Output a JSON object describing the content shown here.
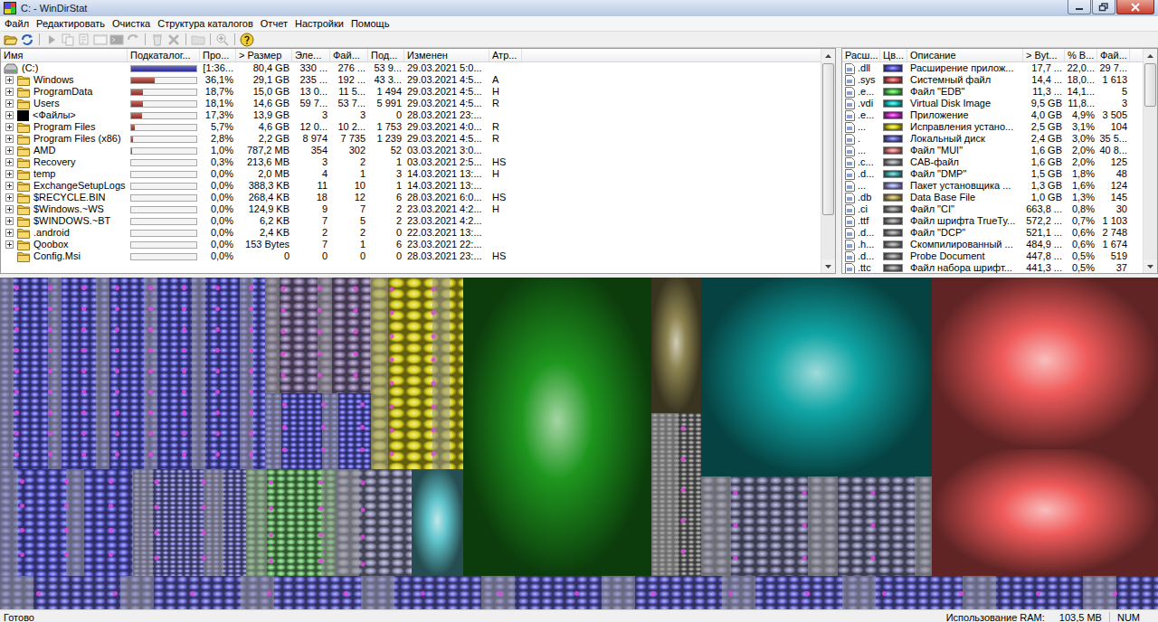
{
  "window": {
    "title": "C: - WinDirStat"
  },
  "menu": [
    "Файл",
    "Редактировать",
    "Очистка",
    "Структура каталогов",
    "Отчет",
    "Настройки",
    "Помощь"
  ],
  "toolbar": [
    {
      "disabled": false
    },
    {
      "disabled": false
    },
    {
      "disabled": true
    },
    {
      "disabled": true
    },
    {
      "disabled": true
    },
    {
      "disabled": true
    },
    {
      "disabled": true
    },
    {
      "disabled": true
    },
    {
      "disabled": true
    },
    {
      "disabled": true
    },
    {
      "disabled": true
    },
    {
      "disabled": true
    },
    {
      "disabled": false
    }
  ],
  "directory_list": {
    "columns": [
      "Имя",
      "Подкаталог...",
      "Про...",
      "> Размер",
      "Эле...",
      "Фай...",
      "Под...",
      "Изменен",
      "Атр..."
    ],
    "scrollbar": {
      "level": 0.78
    },
    "rows": [
      {
        "kind": "drive",
        "expandable": false,
        "name": "(C:)",
        "level": 1.0,
        "percent": "[1:36...",
        "size": "80,4 GB",
        "items": "330 ...",
        "files": "276 ...",
        "subdirs": "53 9...",
        "modified": "29.03.2021 5:0...",
        "attributes": ""
      },
      {
        "kind": "folder",
        "expandable": true,
        "name": "Windows",
        "level": 0.361,
        "percent": "36,1%",
        "size": "29,1 GB",
        "items": "235 ...",
        "files": "192 ...",
        "subdirs": "43 3...",
        "modified": "29.03.2021 4:5...",
        "attributes": "A"
      },
      {
        "kind": "folder",
        "expandable": true,
        "name": "ProgramData",
        "level": 0.187,
        "percent": "18,7%",
        "size": "15,0 GB",
        "items": "13 0...",
        "files": "11 5...",
        "subdirs": "1 494",
        "modified": "29.03.2021 4:5...",
        "attributes": "H"
      },
      {
        "kind": "folder",
        "expandable": true,
        "name": "Users",
        "level": 0.181,
        "percent": "18,1%",
        "size": "14,6 GB",
        "items": "59 7...",
        "files": "53 7...",
        "subdirs": "5 991",
        "modified": "29.03.2021 4:5...",
        "attributes": "R"
      },
      {
        "kind": "files",
        "expandable": true,
        "name": "<Файлы>",
        "level": 0.173,
        "percent": "17,3%",
        "size": "13,9 GB",
        "items": "3",
        "files": "3",
        "subdirs": "0",
        "modified": "28.03.2021 23:...",
        "attributes": ""
      },
      {
        "kind": "folder",
        "expandable": true,
        "name": "Program Files",
        "level": 0.057,
        "percent": "5,7%",
        "size": "4,6 GB",
        "items": "12 0...",
        "files": "10 2...",
        "subdirs": "1 753",
        "modified": "29.03.2021 4:0...",
        "attributes": "R"
      },
      {
        "kind": "folder",
        "expandable": true,
        "name": "Program Files (x86)",
        "level": 0.028,
        "percent": "2,8%",
        "size": "2,2 GB",
        "items": "8 974",
        "files": "7 735",
        "subdirs": "1 239",
        "modified": "29.03.2021 4:5...",
        "attributes": "R"
      },
      {
        "kind": "folder",
        "expandable": true,
        "name": "AMD",
        "level": 0.01,
        "percent": "1,0%",
        "size": "787,2 MB",
        "items": "354",
        "files": "302",
        "subdirs": "52",
        "modified": "03.03.2021 3:0...",
        "attributes": ""
      },
      {
        "kind": "folder",
        "expandable": true,
        "name": "Recovery",
        "level": 0.003,
        "percent": "0,3%",
        "size": "213,6 MB",
        "items": "3",
        "files": "2",
        "subdirs": "1",
        "modified": "03.03.2021 2:5...",
        "attributes": "HS"
      },
      {
        "kind": "folder",
        "expandable": true,
        "name": "temp",
        "level": 0.0,
        "percent": "0,0%",
        "size": "2,0 MB",
        "items": "4",
        "files": "1",
        "subdirs": "3",
        "modified": "14.03.2021 13:...",
        "attributes": "H"
      },
      {
        "kind": "folder",
        "expandable": true,
        "name": "ExchangeSetupLogs",
        "level": 0.0,
        "percent": "0,0%",
        "size": "388,3 KB",
        "items": "11",
        "files": "10",
        "subdirs": "1",
        "modified": "14.03.2021 13:...",
        "attributes": ""
      },
      {
        "kind": "folder",
        "expandable": true,
        "name": "$RECYCLE.BIN",
        "level": 0.0,
        "percent": "0,0%",
        "size": "268,4 KB",
        "items": "18",
        "files": "12",
        "subdirs": "6",
        "modified": "28.03.2021 6:0...",
        "attributes": "HS"
      },
      {
        "kind": "folder",
        "expandable": true,
        "name": "$Windows.~WS",
        "level": 0.0,
        "percent": "0,0%",
        "size": "124,9 KB",
        "items": "9",
        "files": "7",
        "subdirs": "2",
        "modified": "23.03.2021 4:2...",
        "attributes": "H"
      },
      {
        "kind": "folder",
        "expandable": true,
        "name": "$WINDOWS.~BT",
        "level": 0.0,
        "percent": "0,0%",
        "size": "6,2 KB",
        "items": "7",
        "files": "5",
        "subdirs": "2",
        "modified": "23.03.2021 4:2...",
        "attributes": ""
      },
      {
        "kind": "folder",
        "expandable": true,
        "name": ".android",
        "level": 0.0,
        "percent": "0,0%",
        "size": "2,4 KB",
        "items": "2",
        "files": "2",
        "subdirs": "0",
        "modified": "22.03.2021 13:...",
        "attributes": ""
      },
      {
        "kind": "folder",
        "expandable": true,
        "name": "Qoobox",
        "level": 0.0,
        "percent": "0,0%",
        "size": "153 Bytes",
        "items": "7",
        "files": "1",
        "subdirs": "6",
        "modified": "23.03.2021 22:...",
        "attributes": ""
      },
      {
        "kind": "folder",
        "expandable": false,
        "name": "Config.Msi",
        "level": 0.0,
        "percent": "0,0%",
        "size": "0",
        "items": "0",
        "files": "0",
        "subdirs": "0",
        "modified": "28.03.2021 23:...",
        "attributes": "HS"
      }
    ]
  },
  "extension_list": {
    "columns": [
      "Расш...",
      "Цв...",
      "Описание",
      "> Byt...",
      "% B...",
      "Фай..."
    ],
    "scrollbar": {
      "level": 0.22
    },
    "rows": [
      {
        "ext": ".dll",
        "color": "#6a6af0",
        "description": "Расширение прилож...",
        "bytes": "17,7 ...",
        "percent": "22,0...",
        "files": "29 7..."
      },
      {
        "ext": ".sys",
        "color": "#f06464",
        "description": "Системный файл",
        "bytes": "14,4 ...",
        "percent": "18,0...",
        "files": "1 613"
      },
      {
        "ext": ".e...",
        "color": "#64e064",
        "description": "Файл \"EDB\"",
        "bytes": "11,3 ...",
        "percent": "14,1...",
        "files": "5"
      },
      {
        "ext": ".vdi",
        "color": "#20dcdc",
        "description": "Virtual Disk Image",
        "bytes": "9,5 GB",
        "percent": "11,8...",
        "files": "3"
      },
      {
        "ext": ".e...",
        "color": "#e040e0",
        "description": "Приложение",
        "bytes": "4,0 GB",
        "percent": "4,9%",
        "files": "3 505"
      },
      {
        "ext": "...",
        "color": "#e0e020",
        "description": "Исправления устано...",
        "bytes": "2,5 GB",
        "percent": "3,1%",
        "files": "104"
      },
      {
        "ext": ".",
        "color": "#7676d8",
        "description": "Локальный диск",
        "bytes": "2,4 GB",
        "percent": "3,0%",
        "files": "35 5..."
      },
      {
        "ext": "...",
        "color": "#f08c8c",
        "description": "Файл \"MUI\"",
        "bytes": "1,6 GB",
        "percent": "2,0%",
        "files": "40 8..."
      },
      {
        "ext": ".c...",
        "color": "#a8a8a8",
        "description": "CAB-файл",
        "bytes": "1,6 GB",
        "percent": "2,0%",
        "files": "125"
      },
      {
        "ext": ".d...",
        "color": "#50bcbc",
        "description": "Файл \"DMP\"",
        "bytes": "1,5 GB",
        "percent": "1,8%",
        "files": "48"
      },
      {
        "ext": "...",
        "color": "#a8a8e8",
        "description": "Пакет установщика ...",
        "bytes": "1,3 GB",
        "percent": "1,6%",
        "files": "124"
      },
      {
        "ext": ".db",
        "color": "#c8b464",
        "description": "Data Base File",
        "bytes": "1,0 GB",
        "percent": "1,3%",
        "files": "145"
      },
      {
        "ext": ".ci",
        "color": "#a0a0a0",
        "description": "Файл \"CI\"",
        "bytes": "663,8 ...",
        "percent": "0,8%",
        "files": "30"
      },
      {
        "ext": ".ttf",
        "color": "#a0a0a0",
        "description": "Файл шрифта TrueTy...",
        "bytes": "572,2 ...",
        "percent": "0,7%",
        "files": "1 103"
      },
      {
        "ext": ".d...",
        "color": "#a0a0a0",
        "description": "Файл \"DCP\"",
        "bytes": "521,1 ...",
        "percent": "0,6%",
        "files": "2 748"
      },
      {
        "ext": ".h...",
        "color": "#a0a0a0",
        "description": "Скомпилированный ...",
        "bytes": "484,9 ...",
        "percent": "0,6%",
        "files": "1 674"
      },
      {
        "ext": ".d...",
        "color": "#a0a0a0",
        "description": "Probe Document",
        "bytes": "447,8 ...",
        "percent": "0,5%",
        "files": "519"
      },
      {
        "ext": ".ttc",
        "color": "#a0a0a0",
        "description": "Файл набора шрифт...",
        "bytes": "441,3 ...",
        "percent": "0,5%",
        "files": "37"
      }
    ]
  },
  "treemap": {
    "kind": "column",
    "size": 1,
    "children": [
      {
        "kind": "row",
        "size": 330,
        "children": [
          {
            "kind": "column",
            "size": 512,
            "children": [
              {
                "kind": "row",
                "size": 212,
                "children": [
                  {
                    "kind": "cluster",
                    "size": 293,
                    "color": "#6464e0"
                  },
                  {
                    "kind": "column",
                    "size": 117,
                    "children": [
                      {
                        "kind": "cluster",
                        "size": 128,
                        "color": "#8c7aa8"
                      },
                      {
                        "kind": "cluster",
                        "size": 84,
                        "color": "#6464e0"
                      }
                    ]
                  },
                  {
                    "kind": "cluster",
                    "size": 102,
                    "color": "#dcd420"
                  }
                ]
              },
              {
                "kind": "row",
                "size": 118,
                "children": [
                  {
                    "kind": "cluster",
                    "size": 147,
                    "color": "#6464e0"
                  },
                  {
                    "kind": "cluster",
                    "size": 125,
                    "color": "#7878c8"
                  },
                  {
                    "kind": "cluster",
                    "size": 100,
                    "color": "#70c070"
                  },
                  {
                    "kind": "cluster",
                    "size": 83,
                    "color": "#9090b4"
                  },
                  {
                    "kind": "tile",
                    "size": 57,
                    "color": "#60c4cc"
                  }
                ]
              }
            ]
          },
          {
            "kind": "tile",
            "size": 208,
            "color": "#1e961e"
          },
          {
            "kind": "column",
            "size": 55,
            "children": [
              {
                "kind": "tile",
                "size": 150,
                "color": "#8c8250"
              },
              {
                "kind": "cluster",
                "size": 180,
                "color": "#848484"
              }
            ]
          },
          {
            "kind": "column",
            "size": 255,
            "children": [
              {
                "kind": "tile",
                "size": 220,
                "color": "#10a4a4"
              },
              {
                "kind": "cluster",
                "size": 110,
                "color": "#8484ac"
              }
            ]
          },
          {
            "kind": "column",
            "size": 250,
            "children": [
              {
                "kind": "tile",
                "size": 190,
                "color": "#f05a5a"
              },
              {
                "kind": "tile",
                "size": 140,
                "color": "#f05a5a"
              }
            ]
          }
        ]
      },
      {
        "kind": "cluster",
        "size": 37,
        "color": "#6a6ad8"
      }
    ]
  },
  "status_bar": {
    "message": "Готово",
    "ram_label": "Использование RAM:",
    "ram_value": "103,5 MB",
    "num": "NUM"
  }
}
